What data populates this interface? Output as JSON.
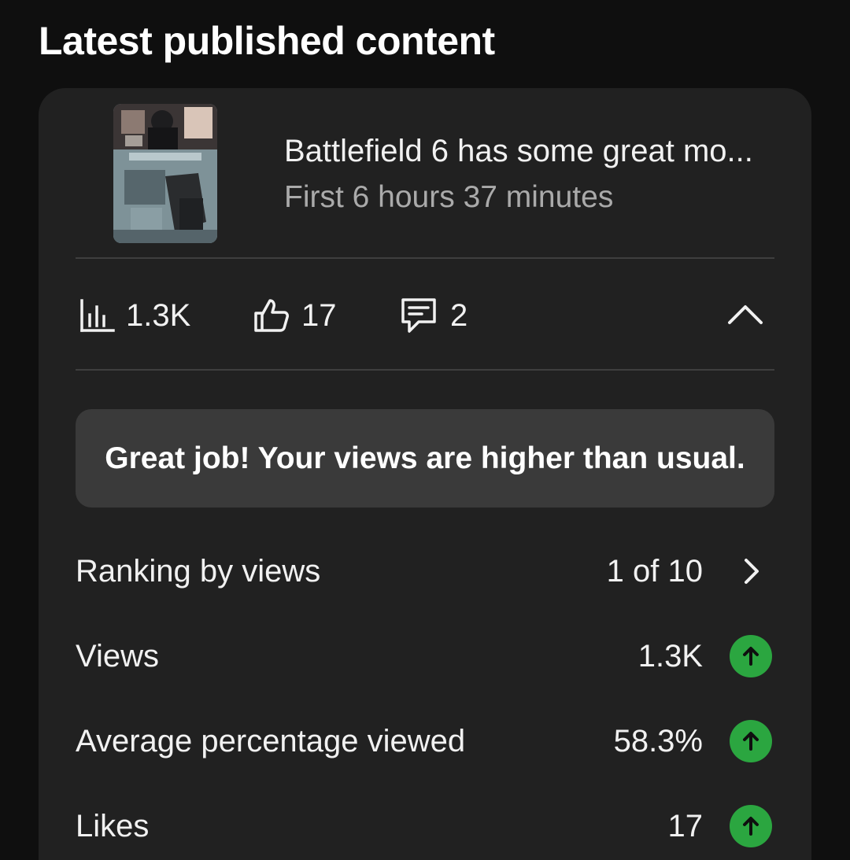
{
  "section": {
    "title": "Latest published content"
  },
  "video": {
    "title": "Battlefield 6 has some great mo...",
    "subtitle": "First 6 hours 37 minutes",
    "thumbnail_icon": "video-thumbnail"
  },
  "stats": {
    "views": {
      "icon": "bar-chart-icon",
      "value": "1.3K"
    },
    "likes": {
      "icon": "thumbs-up-icon",
      "value": "17"
    },
    "comments": {
      "icon": "comment-icon",
      "value": "2"
    },
    "collapse_icon": "chevron-up-icon"
  },
  "banner": {
    "text": "Great job! Your views are higher than usual."
  },
  "metrics": [
    {
      "label": "Ranking by views",
      "value": "1 of 10",
      "indicator": "chevron-right-icon"
    },
    {
      "label": "Views",
      "value": "1.3K",
      "indicator": "arrow-up-icon",
      "trend": "up"
    },
    {
      "label": "Average percentage viewed",
      "value": "58.3%",
      "indicator": "arrow-up-icon",
      "trend": "up"
    },
    {
      "label": "Likes",
      "value": "17",
      "indicator": "arrow-up-icon",
      "trend": "up"
    }
  ],
  "colors": {
    "background": "#0f0f0f",
    "card": "#212121",
    "banner": "#3a3a3a",
    "trend_up": "#2ba640",
    "secondary_text": "#aaaaaa"
  }
}
